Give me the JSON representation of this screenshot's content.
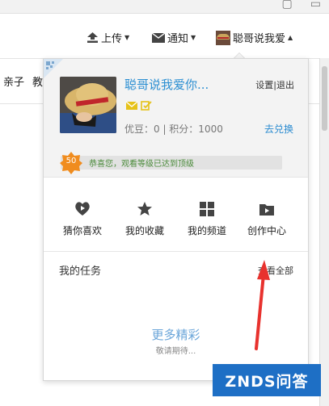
{
  "header": {
    "upload": "上传",
    "notify": "通知",
    "username_short": "聪哥说我爱"
  },
  "subnav": {
    "items": [
      "亲子",
      "教"
    ]
  },
  "profile": {
    "username": "聪哥说我爱你...",
    "settings": "设置",
    "separator": "|",
    "logout": "退出",
    "stats": "优豆：0 | 积分：1000",
    "exchange": "去兑换",
    "level": "50",
    "level_message": "恭喜您，观看等级已达到顶级"
  },
  "shortcuts": [
    {
      "label": "猜你喜欢",
      "icon": "heart-play-icon"
    },
    {
      "label": "我的收藏",
      "icon": "star-icon"
    },
    {
      "label": "我的频道",
      "icon": "grid-icon"
    },
    {
      "label": "创作中心",
      "icon": "folder-play-icon"
    }
  ],
  "tasks": {
    "title": "我的任务",
    "view_all": "查看全部",
    "more": "更多精彩",
    "coming_soon": "敬请期待..."
  },
  "watermark": "ZNDS问答",
  "colors": {
    "link_blue": "#2c8fd2",
    "level_orange": "#f08c1e",
    "level_green_text": "#4b8b3b",
    "badge_yellow": "#e6c21a",
    "arrow_red": "#e8322e",
    "watermark_blue": "#1e6fc5"
  }
}
